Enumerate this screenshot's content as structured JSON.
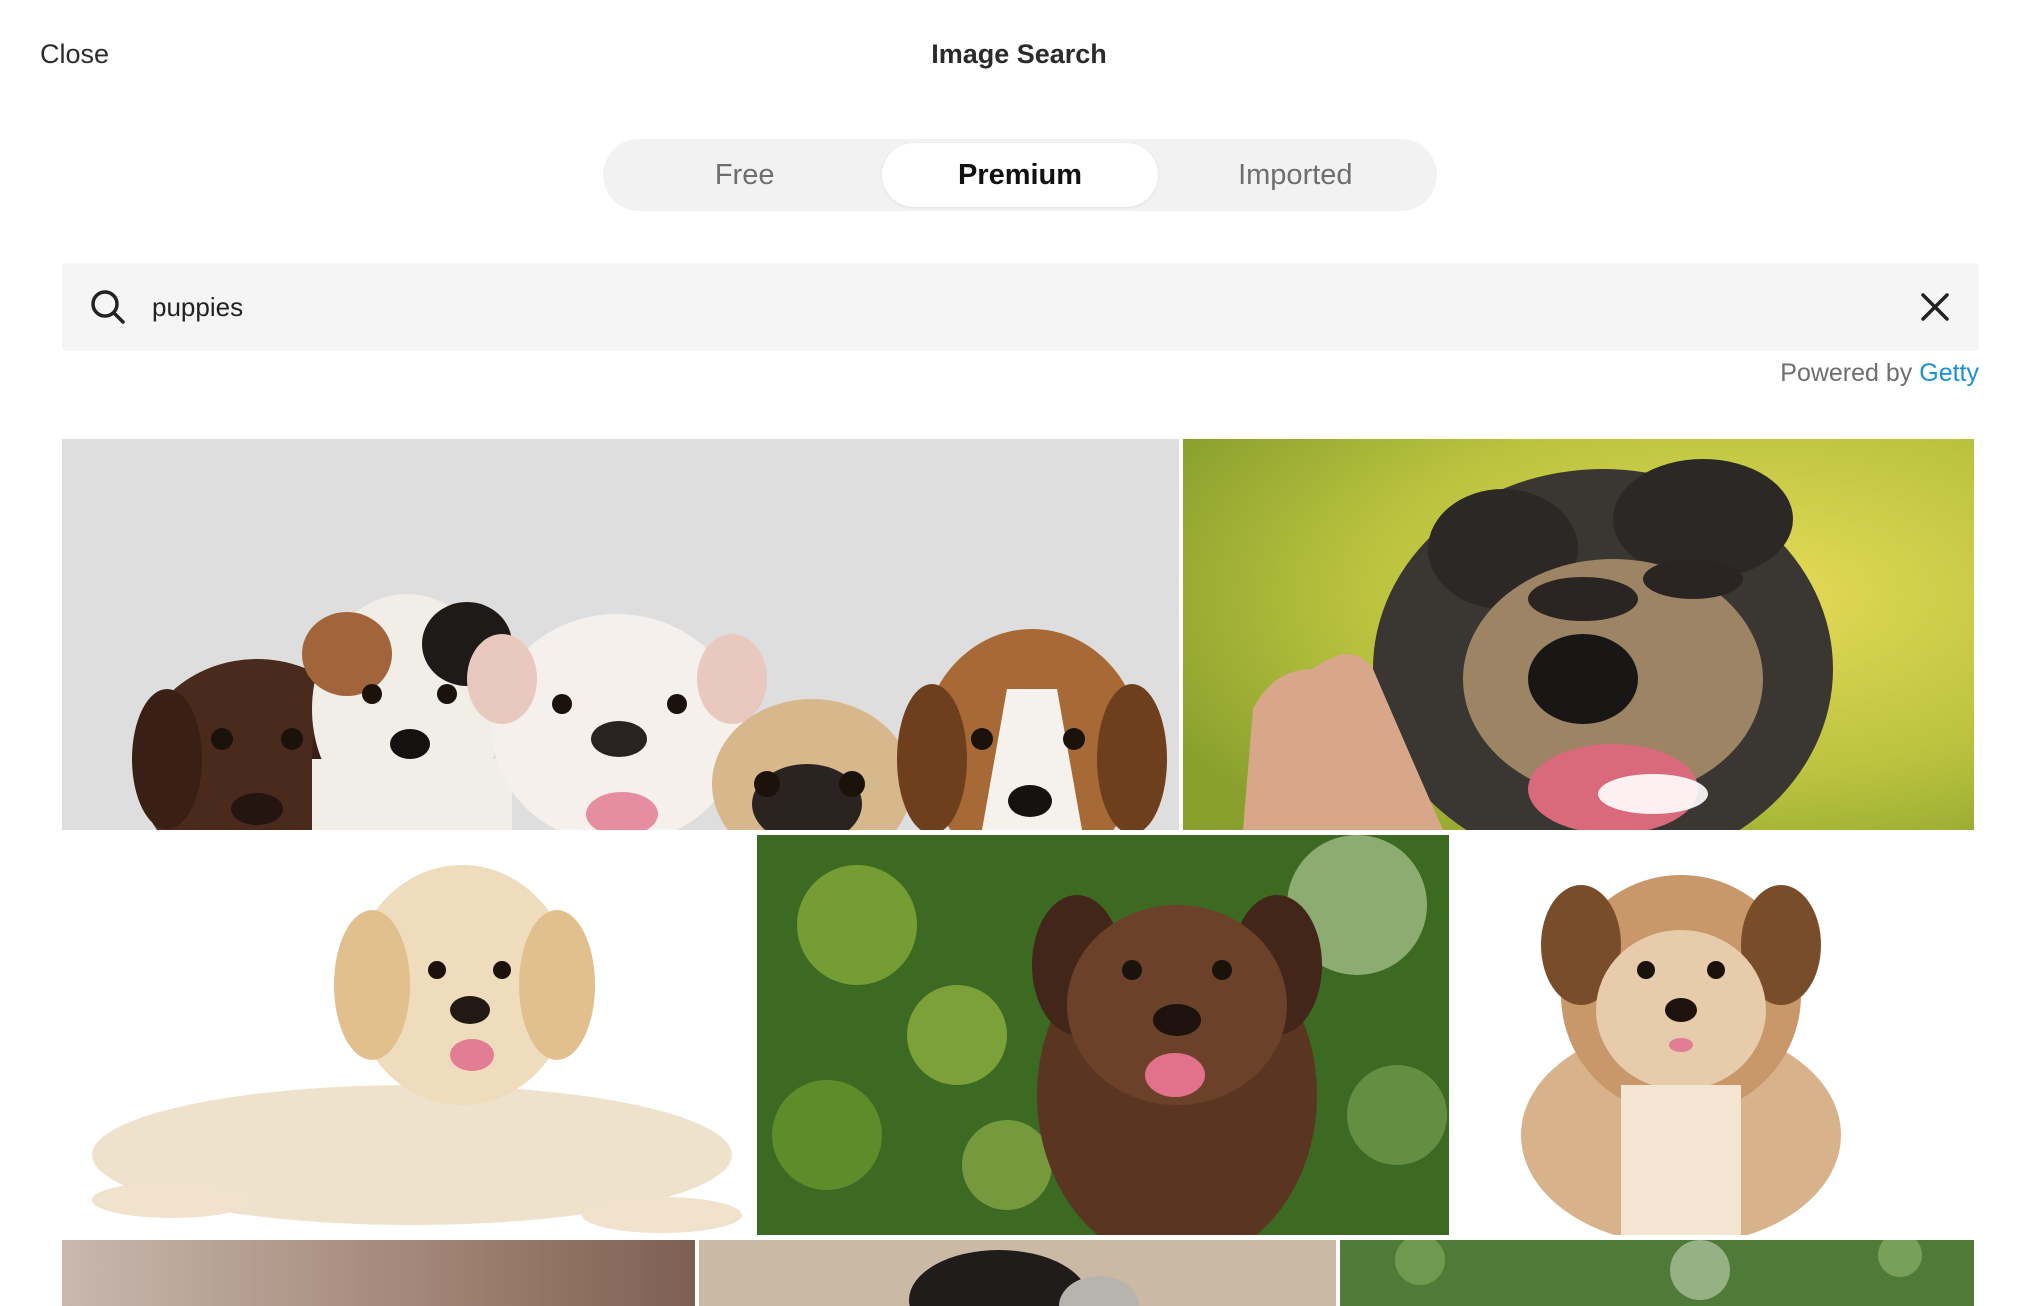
{
  "header": {
    "close_label": "Close",
    "title": "Image Search"
  },
  "tabs": [
    {
      "label": "Free",
      "active": false
    },
    {
      "label": "Premium",
      "active": true
    },
    {
      "label": "Imported",
      "active": false
    }
  ],
  "search": {
    "value": "puppies",
    "placeholder": "Search"
  },
  "attribution": {
    "prefix": "Powered by",
    "provider": "Getty"
  },
  "colors": {
    "tab_bg": "#f2f2f2",
    "search_bg": "#f5f5f5",
    "link": "#1a8fd8"
  },
  "icons": {
    "search": "search-icon",
    "clear": "close-icon"
  }
}
